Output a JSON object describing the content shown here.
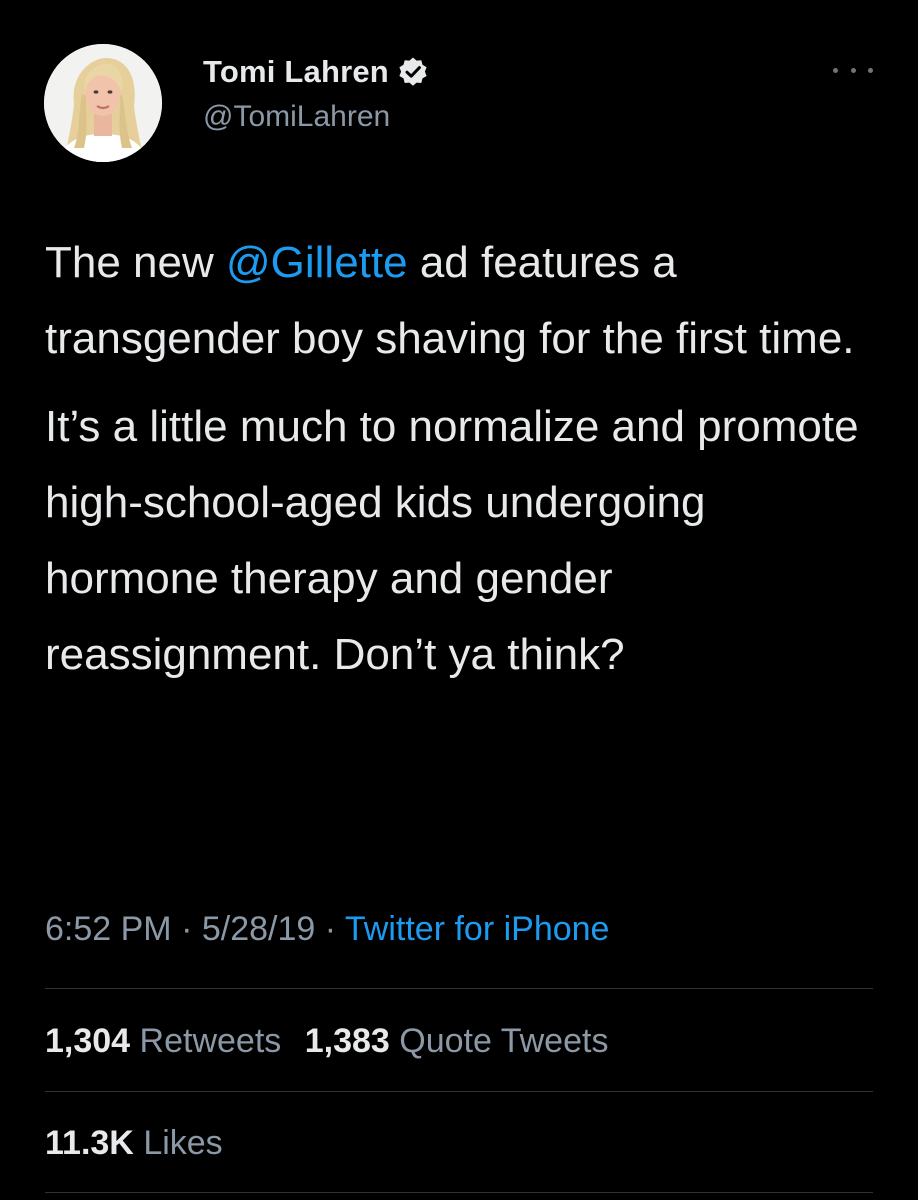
{
  "author": {
    "display_name": "Tomi Lahren",
    "handle": "@TomiLahren",
    "verified": true
  },
  "tweet": {
    "paragraph1_before": "The new ",
    "paragraph1_mention": "@Gillette",
    "paragraph1_after": " ad features a transgender boy shaving for the first time.",
    "paragraph2": "It’s a little much to normalize and promote high-school-aged kids undergoing hormone therapy and gender reassignment. Don’t ya think?"
  },
  "meta": {
    "time": "6:52 PM",
    "separator": " · ",
    "date": "5/28/19",
    "source": "Twitter for iPhone"
  },
  "stats": {
    "retweets_count": "1,304",
    "retweets_label": "Retweets",
    "quotes_count": "1,383",
    "quotes_label": "Quote Tweets",
    "likes_count": "11.3K",
    "likes_label": "Likes"
  },
  "colors": {
    "background": "#000000",
    "text": "#e7e9ea",
    "secondary": "#8b98a5",
    "link": "#1d9bf0",
    "divider": "#2f3336"
  },
  "icons": {
    "verified": "verified-badge-icon",
    "more": "more-options-icon"
  }
}
